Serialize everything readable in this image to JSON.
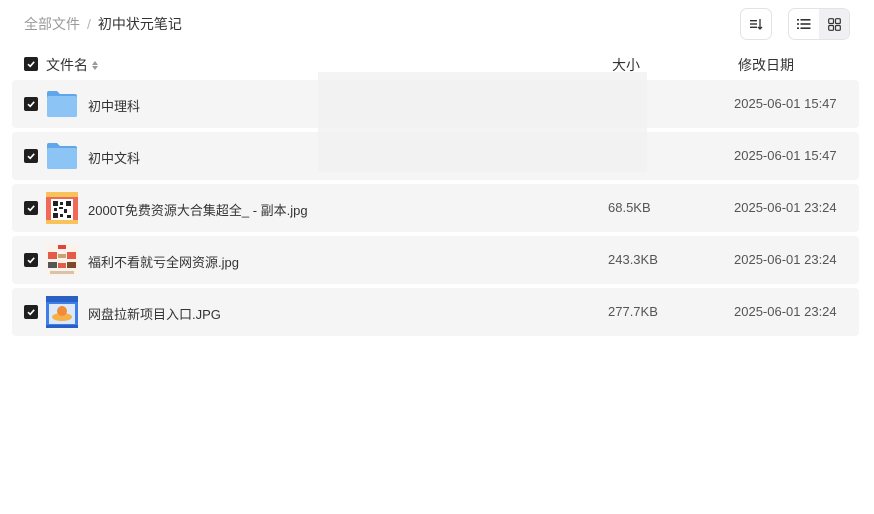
{
  "breadcrumb": {
    "root": "全部文件",
    "separator": "/",
    "current": "初中状元笔记"
  },
  "header": {
    "name": "文件名",
    "size": "大小",
    "date": "修改日期"
  },
  "files": [
    {
      "name": "初中理科",
      "size": "",
      "date": "2025-06-01 15:47",
      "type": "folder",
      "icon": "folder-icon"
    },
    {
      "name": "初中文科",
      "size": "",
      "date": "2025-06-01 15:47",
      "type": "folder",
      "icon": "folder-icon"
    },
    {
      "name": "2000T免费资源大合集超全_ - 副本.jpg",
      "size": "68.5KB",
      "date": "2025-06-01 23:24",
      "type": "image",
      "icon": "qr-image-thumbnail"
    },
    {
      "name": "福利不看就亏全网资源.jpg",
      "size": "243.3KB",
      "date": "2025-06-01 23:24",
      "type": "image",
      "icon": "poster-image-thumbnail"
    },
    {
      "name": "网盘拉新项目入口.JPG",
      "size": "277.7KB",
      "date": "2025-06-01 23:24",
      "type": "image",
      "icon": "promo-image-thumbnail"
    }
  ],
  "colors": {
    "checkbox": "#1f1f1f",
    "row_background": "#f5f5f5",
    "folder": "#7cb8f2"
  }
}
